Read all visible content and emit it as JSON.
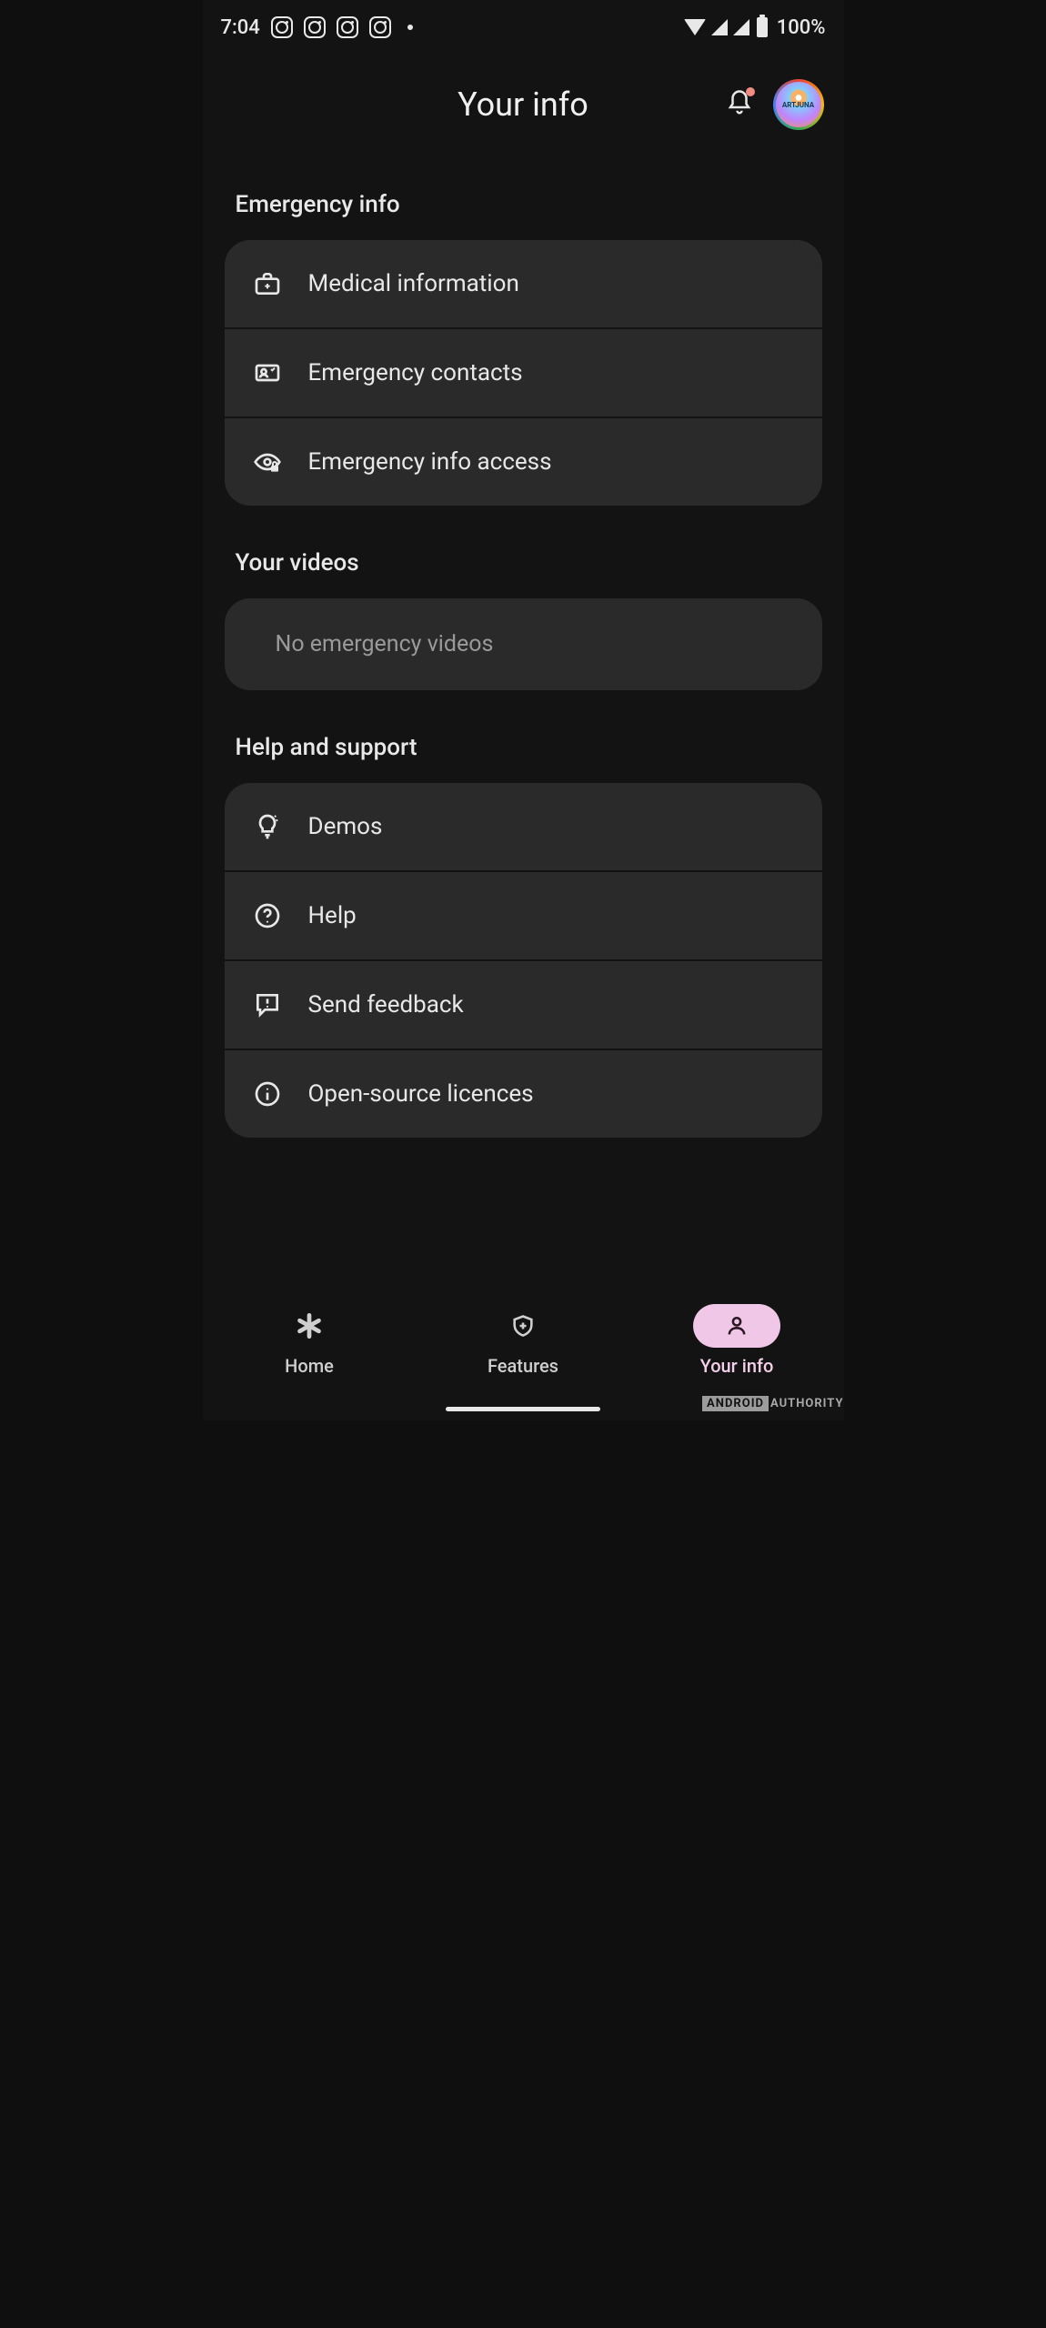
{
  "status": {
    "time": "7:04",
    "battery": "100%"
  },
  "header": {
    "title": "Your info",
    "avatar_label": "ARTJUNA"
  },
  "sections": {
    "emergency": {
      "title": "Emergency info",
      "items": [
        {
          "label": "Medical information"
        },
        {
          "label": "Emergency contacts"
        },
        {
          "label": "Emergency info access"
        }
      ]
    },
    "videos": {
      "title": "Your videos",
      "empty": "No emergency videos"
    },
    "help": {
      "title": "Help and support",
      "items": [
        {
          "label": "Demos"
        },
        {
          "label": "Help"
        },
        {
          "label": "Send feedback"
        },
        {
          "label": "Open-source licences"
        }
      ]
    }
  },
  "nav": {
    "home": "Home",
    "features": "Features",
    "yourinfo": "Your info"
  },
  "watermark": {
    "brand": "ANDROID",
    "sub": "AUTHORITY"
  }
}
